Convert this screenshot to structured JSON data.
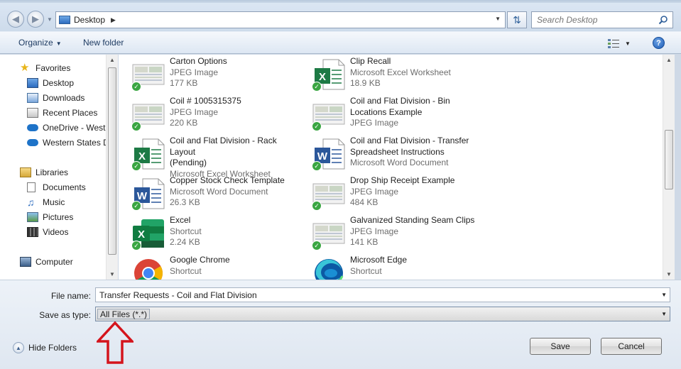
{
  "address": {
    "location": "Desktop",
    "search_placeholder": "Search Desktop"
  },
  "toolbar": {
    "organize": "Organize",
    "new_folder": "New folder",
    "help": "?"
  },
  "nav": {
    "favorites": "Favorites",
    "fav_items": [
      "Desktop",
      "Downloads",
      "Recent Places",
      "OneDrive - Weste",
      "Western States D"
    ],
    "libraries": "Libraries",
    "lib_items": [
      "Documents",
      "Music",
      "Pictures",
      "Videos"
    ],
    "computer": "Computer"
  },
  "files": [
    {
      "name1": "Carton Options",
      "name2": "",
      "type": "JPEG Image",
      "size": "177 KB",
      "icon": "jpeg-thumbnail-icon"
    },
    {
      "name1": "Clip Recall",
      "name2": "",
      "type": "Microsoft Excel Worksheet",
      "size": "18.9 KB",
      "icon": "excel-file-icon"
    },
    {
      "name1": "Coil # 1005315375",
      "name2": "",
      "type": "JPEG Image",
      "size": "220 KB",
      "icon": "jpeg-thumbnail-icon"
    },
    {
      "name1": "Coil and Flat Division - Bin",
      "name2": "Locations Example",
      "type": "JPEG Image",
      "size": "",
      "icon": "jpeg-thumbnail-icon"
    },
    {
      "name1": "Coil and Flat Division - Rack Layout",
      "name2": "(Pending)",
      "type": "Microsoft Excel Worksheet",
      "size": "",
      "icon": "excel-file-icon"
    },
    {
      "name1": "Coil and Flat Division - Transfer",
      "name2": "Spreadsheet Instructions",
      "type": "Microsoft Word Document",
      "size": "",
      "icon": "word-file-icon"
    },
    {
      "name1": "Copper Stock Check Template",
      "name2": "",
      "type": "Microsoft Word Document",
      "size": "26.3 KB",
      "icon": "word-file-icon"
    },
    {
      "name1": "Drop Ship Receipt Example",
      "name2": "",
      "type": "JPEG Image",
      "size": "484 KB",
      "icon": "jpeg-thumbnail-icon"
    },
    {
      "name1": "Excel",
      "name2": "",
      "type": "Shortcut",
      "size": "2.24 KB",
      "icon": "excel-app-icon"
    },
    {
      "name1": "Galvanized Standing Seam Clips",
      "name2": "",
      "type": "JPEG Image",
      "size": "141 KB",
      "icon": "jpeg-thumbnail-icon"
    },
    {
      "name1": "Google Chrome",
      "name2": "",
      "type": "Shortcut",
      "size": "",
      "icon": "chrome-icon"
    },
    {
      "name1": "Microsoft Edge",
      "name2": "",
      "type": "Shortcut",
      "size": "",
      "icon": "edge-icon"
    }
  ],
  "form": {
    "file_name_label": "File name:",
    "file_name_value": "Transfer Requests - Coil and Flat Division",
    "save_type_label": "Save as type:",
    "save_type_value": "All Files (*.*)",
    "hide_folders": "Hide Folders",
    "save": "Save",
    "cancel": "Cancel"
  },
  "colors": {
    "accent_blue": "#2d6cbf",
    "excel_green": "#1d7a45",
    "word_blue": "#2b579a",
    "sync_check": "#3aa642",
    "annotation_red": "#d4141c"
  }
}
